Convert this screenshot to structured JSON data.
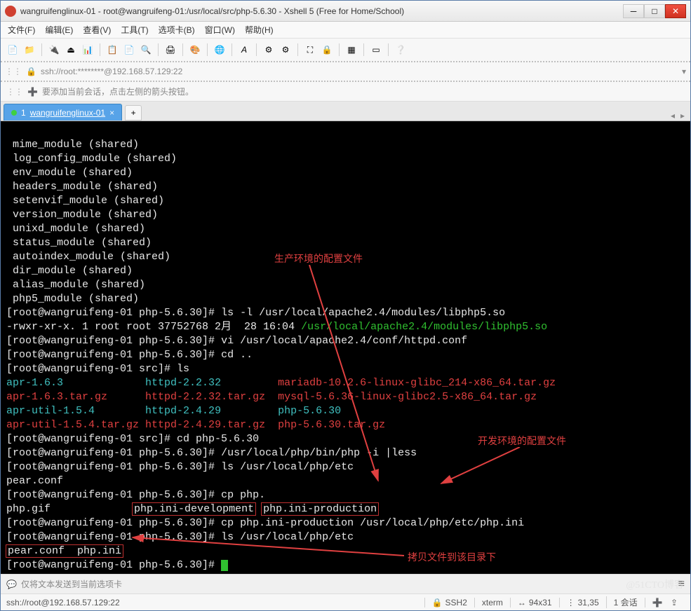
{
  "window": {
    "title": "wangruifenglinux-01 - root@wangruifeng-01:/usr/local/src/php-5.6.30 - Xshell 5 (Free for Home/School)"
  },
  "menu": {
    "file": "文件(F)",
    "edit": "编辑(E)",
    "view": "查看(V)",
    "tools": "工具(T)",
    "tabs": "选项卡(B)",
    "window": "窗口(W)",
    "help": "帮助(H)"
  },
  "address": {
    "text": "ssh://root:********@192.168.57.129:22"
  },
  "hint": {
    "text": "要添加当前会话，点击左侧的箭头按钮。"
  },
  "tab": {
    "index": "1",
    "label": "wangruifenglinux-01",
    "add": "+"
  },
  "term": {
    "l01": " mime_module (shared)",
    "l02": " log_config_module (shared)",
    "l03": " env_module (shared)",
    "l04": " headers_module (shared)",
    "l05": " setenvif_module (shared)",
    "l06": " version_module (shared)",
    "l07": " unixd_module (shared)",
    "l08": " status_module (shared)",
    "l09": " autoindex_module (shared)",
    "l10": " dir_module (shared)",
    "l11": " alias_module (shared)",
    "l12": " php5_module (shared)",
    "p1": "[root@wangruifeng-01 php-5.6.30]# ",
    "p1c": "ls -l /usr/local/apache2.4/modules/libphp5.so",
    "perm": "-rwxr-xr-x. 1 root root 37752768 2月  28 16:04 ",
    "permPath": "/usr/local/apache2.4/modules/libphp5.so",
    "p2c": "vi /usr/local/apache2.4/conf/httpd.conf",
    "p3c": "cd ..",
    "p4": "[root@wangruifeng-01 src]# ",
    "p4c": "ls",
    "f_apr": "apr-1.6.3",
    "f_httpd22": "httpd-2.2.32",
    "f_mariadb": "mariadb-10.2.6-linux-glibc_214-x86_64.tar.gz",
    "f_apr_tgz": "apr-1.6.3.tar.gz",
    "f_httpd22_tgz": "httpd-2.2.32.tar.gz",
    "f_mysql": "mysql-5.6.36-linux-glibc2.5-x86_64.tar.gz",
    "f_aprutil": "apr-util-1.5.4",
    "f_httpd24": "httpd-2.4.29",
    "f_php": "php-5.6.30",
    "f_aprutil_tgz": "apr-util-1.5.4.tar.gz",
    "f_httpd24_tgz": "httpd-2.4.29.tar.gz",
    "f_php_tgz": "php-5.6.30.tar.gz",
    "p5c": "cd php-5.6.30",
    "p6c": "/usr/local/php/bin/php -i |less",
    "p7c": "ls /usr/local/php/etc",
    "pear": "pear.conf",
    "p8c": "cp php.",
    "tab1": "php.gif",
    "tab2": "php.ini-development",
    "tab3": "php.ini-production",
    "p9c": "cp php.ini-production /usr/local/php/etc/php.ini",
    "p10c": "ls /usr/local/php/etc",
    "res": "pear.conf  php.ini",
    "annot1": "生产环境的配置文件",
    "annot2": "开发环境的配置文件",
    "annot3": "拷贝文件到该目录下"
  },
  "inputbar": {
    "text": "仅将文本发送到当前选项卡"
  },
  "status": {
    "conn": "ssh://root@192.168.57.129:22",
    "ssh": "SSH2",
    "term": "xterm",
    "size": "94x31",
    "pos": "31,35",
    "sessions": "1 会话"
  },
  "watermark": "@51CTO博客"
}
